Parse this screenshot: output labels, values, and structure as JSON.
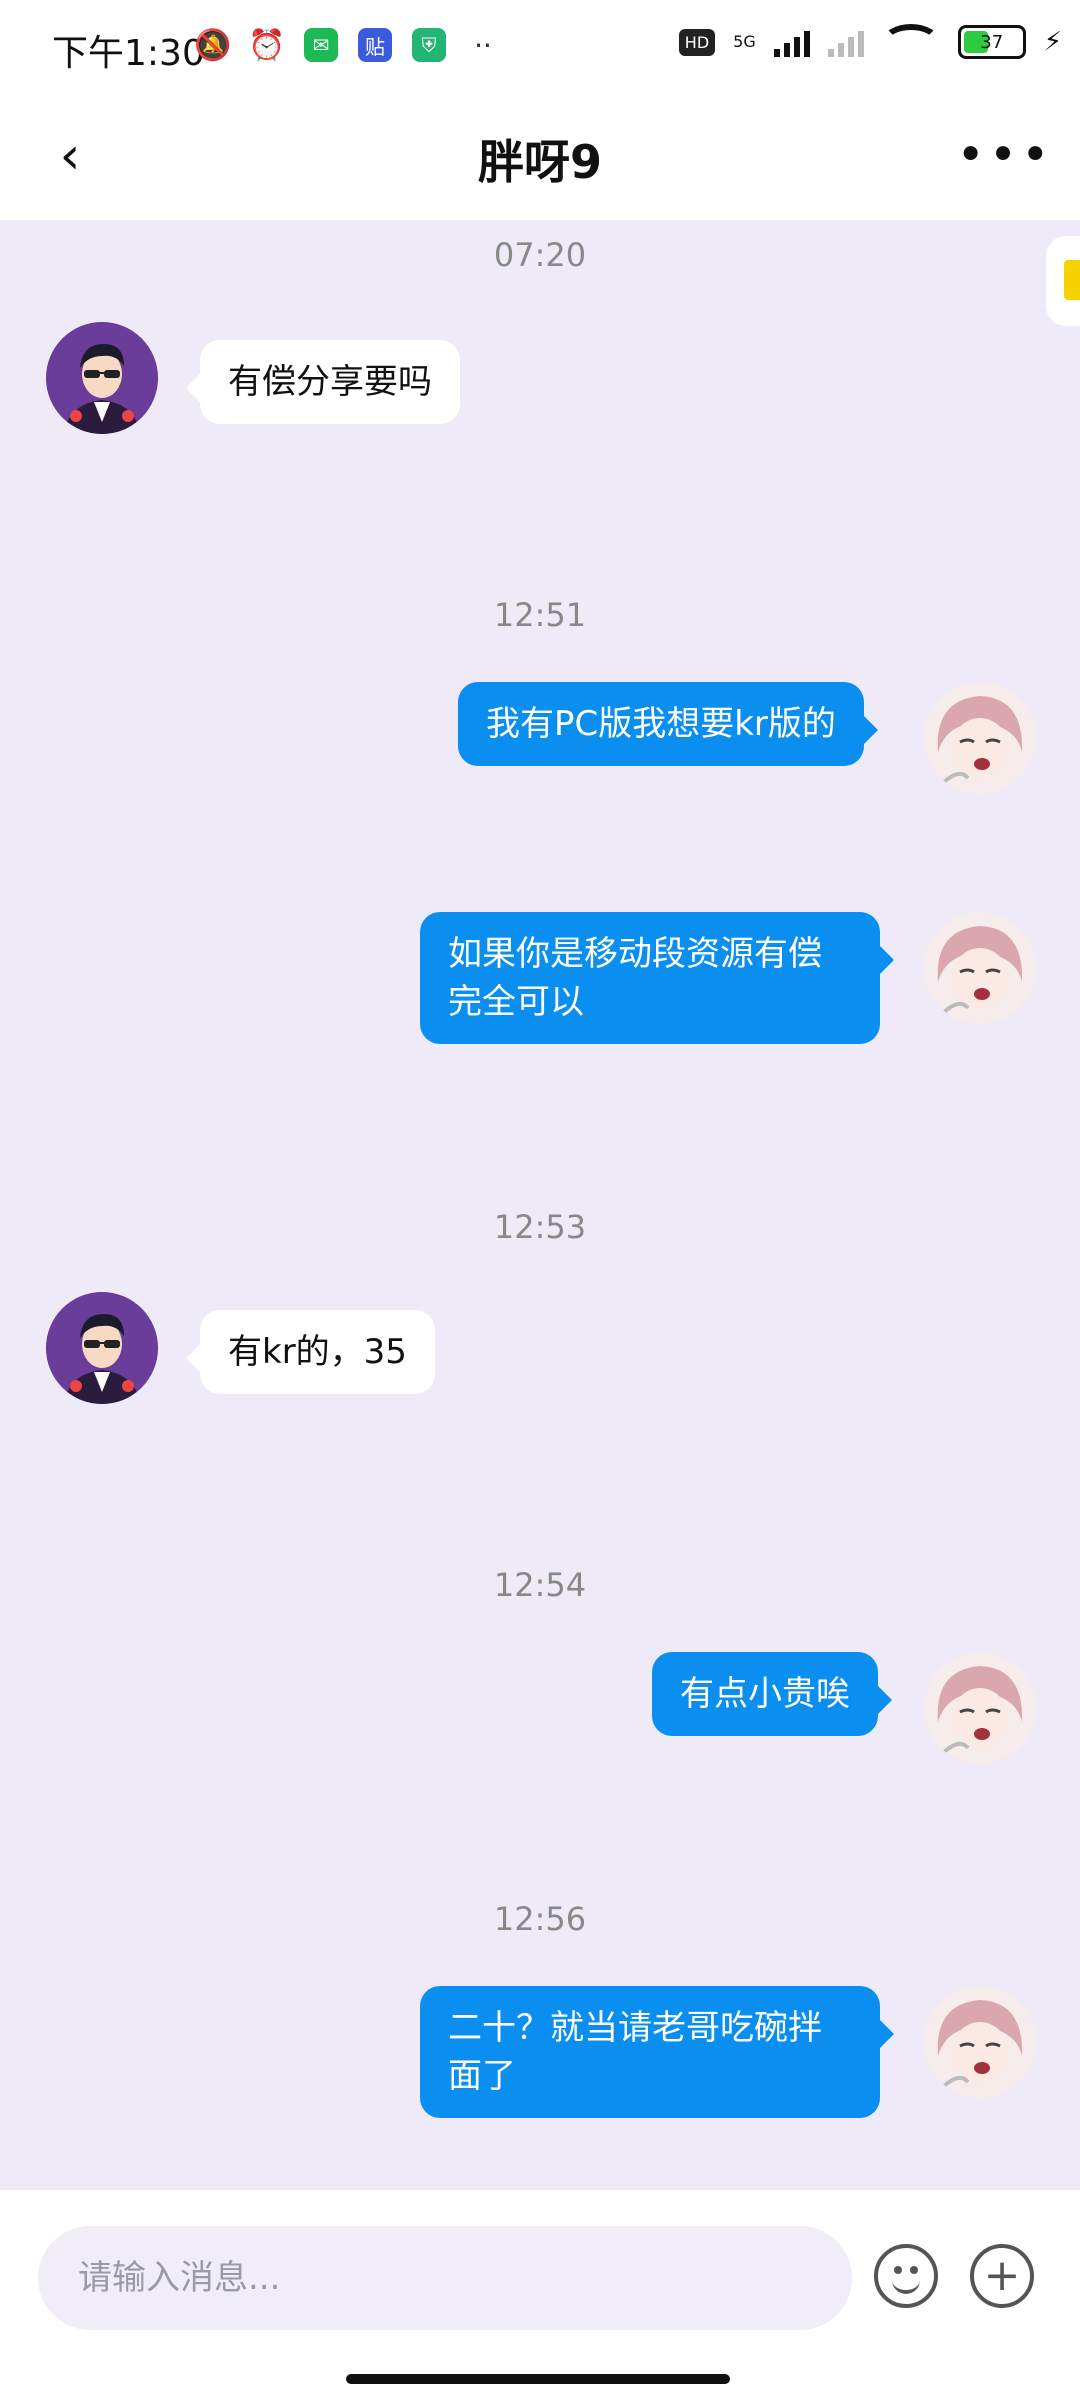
{
  "status_bar": {
    "time": "下午1:30",
    "wechat_icon": "wechat-icon",
    "tieba_label": "贴",
    "hd": "HD",
    "network": "5G",
    "battery": "37"
  },
  "header": {
    "title": "胖呀9"
  },
  "messages": [
    {
      "type": "time",
      "text": "07:20"
    },
    {
      "type": "in",
      "text": "有偿分享要吗"
    },
    {
      "type": "time",
      "text": "12:51"
    },
    {
      "type": "out",
      "text": "我有PC版我想要kr版的"
    },
    {
      "type": "out",
      "text": "如果你是移动段资源有偿完全可以"
    },
    {
      "type": "time",
      "text": "12:53"
    },
    {
      "type": "in",
      "text": "有kr的，35"
    },
    {
      "type": "time",
      "text": "12:54"
    },
    {
      "type": "out",
      "text": "有点小贵唉"
    },
    {
      "type": "time",
      "text": "12:56"
    },
    {
      "type": "out",
      "text": "二十？就当请老哥吃碗拌面了"
    }
  ],
  "input": {
    "placeholder": "请输入消息..."
  },
  "colors": {
    "outgoing_bubble": "#0a8ff0",
    "chat_background": "#efeaf8"
  }
}
